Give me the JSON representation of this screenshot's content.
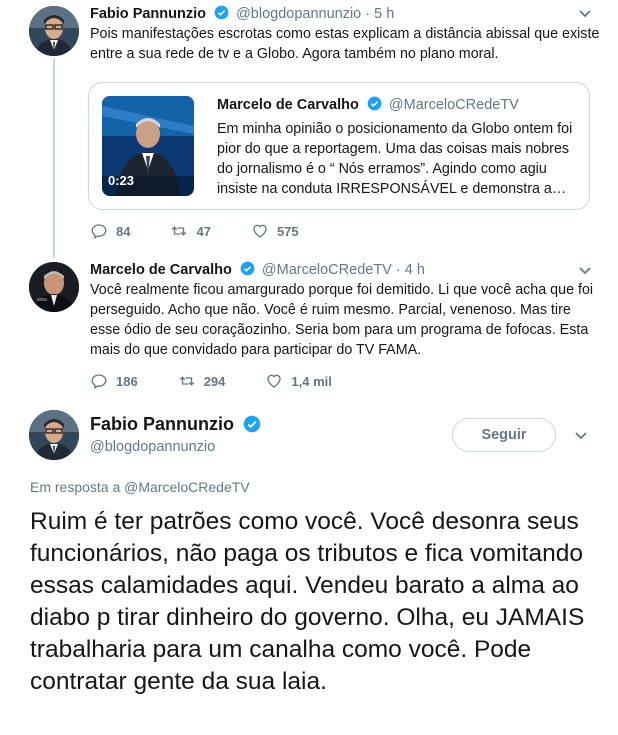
{
  "tweet1": {
    "name": "Fabio Pannunzio",
    "handle": "@blogdopannunzio",
    "time": "· 5 h",
    "text": "Pois manifestações escrotas como estas explicam a distância abissal que existe entre a sua rede de tv e a Globo. Agora também no plano moral.",
    "quote": {
      "name": "Marcelo de Carvalho",
      "handle": "@MarceloCRedeTV",
      "text": "Em minha opinião o posicionamento da Globo ontem foi pior do que a reportagem. Uma das coisas mais nobres do jornalismo é o “ Nós erramos”. Agindo como agiu insiste na conduta IRRESPONSÁVEL e demonstra a…",
      "video_duration": "0:23"
    },
    "replies": "84",
    "retweets": "47",
    "likes": "575"
  },
  "tweet2": {
    "name": "Marcelo de Carvalho",
    "handle": "@MarceloCRedeTV",
    "time": "· 4 h",
    "text": "Você realmente ficou amargurado  porque foi demitido. Li que você acha que foi perseguido. Acho que não. Você é ruim mesmo. Parcial, venenoso. Mas tire esse ódio de seu coraçãozinho. Seria bom para um programa de fofocas. Esta mais do que convidado para participar do TV FAMA.",
    "replies": "186",
    "retweets": "294",
    "likes": "1,4 mil"
  },
  "main": {
    "name": "Fabio Pannunzio",
    "handle": "@blogdopannunzio",
    "follow_label": "Seguir",
    "reply_prefix": "Em resposta a",
    "reply_to": "@MarceloCRedeTV",
    "text": "Ruim é ter patrões como você. Você desonra seus funcionários, não paga os tributos e fica vomitando essas calamidades aqui. Vendeu barato a alma ao diabo p  tirar dinheiro do governo.  Olha, eu JAMAIS trabalharia para um canalha como você. Pode contratar gente da sua laia."
  },
  "colors": {
    "verified": "#1da1f2",
    "muted": "#657786",
    "border": "#ccd6dd"
  },
  "icons": [
    "verified-icon",
    "chevron-down-icon",
    "reply-icon",
    "retweet-icon",
    "like-icon"
  ]
}
